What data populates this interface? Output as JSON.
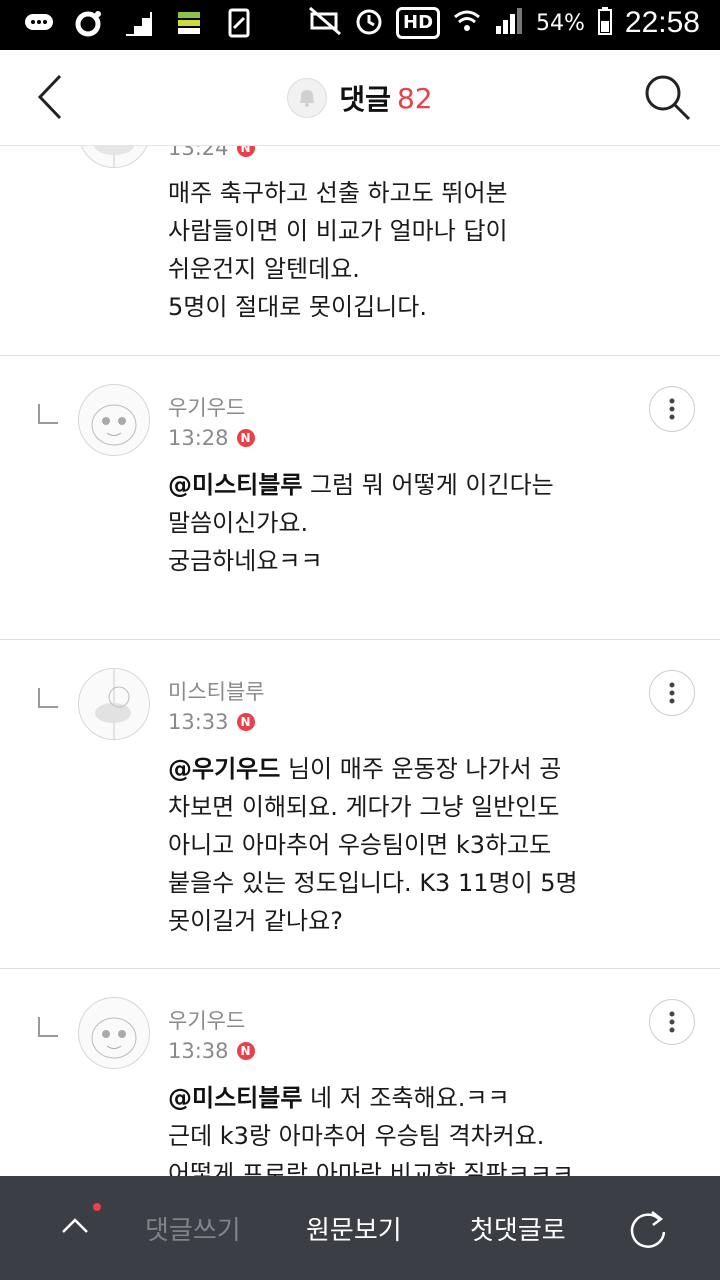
{
  "status_bar": {
    "battery": "54%",
    "time": "22:58",
    "hd_label": "HD",
    "icons": [
      "chat-bubble-icon",
      "circle-icon",
      "stairs-icon",
      "stack-icon",
      "document-icon",
      "mute-icon",
      "alarm-icon",
      "hd-icon",
      "wifi-icon",
      "signal-icon",
      "battery-icon"
    ]
  },
  "header": {
    "title": "댓글",
    "count": "82",
    "icons": [
      "back-arrow-icon",
      "bell-icon",
      "search-icon"
    ]
  },
  "comments": [
    {
      "nick": "",
      "time": "13:24",
      "badge": "N",
      "lines": [
        "매주 축구하고 선출 하고도 뛰어본",
        "사람들이면 이 비교가 얼마나 답이",
        "쉬운건지 알텐데요.",
        "5명이 절대로 못이깁니다."
      ]
    },
    {
      "nick": "우기우드",
      "time": "13:28",
      "badge": "N",
      "mention": "@미스티블루",
      "lines": [
        "그럼 뭐 어떻게 이긴다는",
        "말씀이신가요.",
        "궁금하네요ㅋㅋ"
      ]
    },
    {
      "nick": "미스티블루",
      "time": "13:33",
      "badge": "N",
      "mention": "@우기우드",
      "lines": [
        "님이 매주 운동장 나가서 공",
        "차보면 이해되요. 게다가 그냥 일반인도",
        "아니고 아마추어 우승팀이면 k3하고도",
        "붙을수 있는 정도입니다. K3 11명이 5명",
        "못이길거 같나요?"
      ]
    },
    {
      "nick": "우기우드",
      "time": "13:38",
      "badge": "N",
      "mention": "@미스티블루",
      "lines": [
        "네 저 조축해요.ㅋㅋ",
        "근데 k3랑 아마추어 우승팀 격차커요.",
        "어떻게 프로랑 아마랑 비교할 질판ㅋㅋㅋ"
      ]
    }
  ],
  "bottom_bar": {
    "write_label": "댓글쓰기",
    "original_label": "원문보기",
    "first_comment_label": "첫댓글로",
    "icons": [
      "chevron-up-icon",
      "refresh-icon"
    ],
    "accent_color": "#e8414a"
  }
}
